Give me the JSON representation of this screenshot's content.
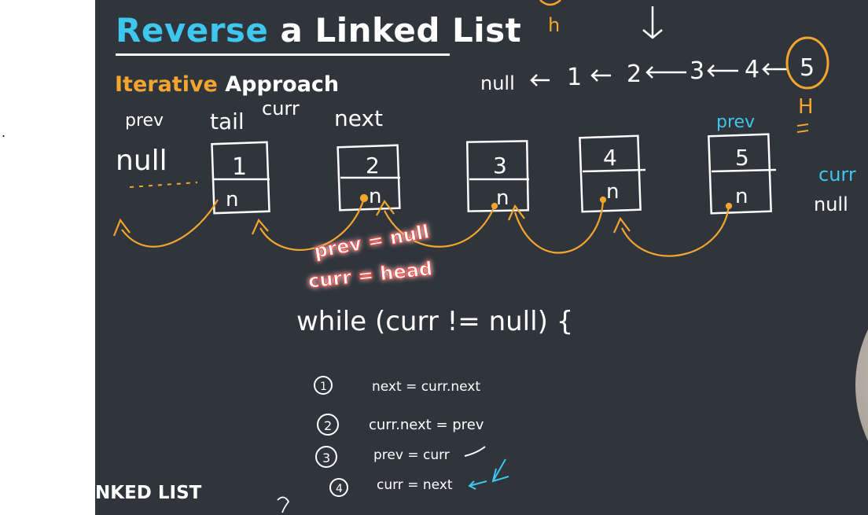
{
  "title": {
    "highlight": "Reverse",
    "rest": " a Linked List"
  },
  "subtitle": {
    "highlight": "Iterative",
    "rest": " Approach"
  },
  "footer": "NKED LIST",
  "colors": {
    "board": "#2f353b",
    "accent_blue": "#3ec6ee",
    "accent_orange": "#f3a52f",
    "highlight_red": "#ff3b30",
    "ink_white": "#ffffff"
  },
  "notes": {
    "reversed_list": {
      "null": "null",
      "nodes": [
        "1",
        "2",
        "3",
        "4",
        "5"
      ],
      "top_h": "h",
      "right_h": "H"
    },
    "pointer_labels": {
      "prev": "prev",
      "tail": "tail",
      "curr": "curr",
      "next": "next",
      "null": "null"
    },
    "nodes": [
      {
        "value": "1",
        "next": "n"
      },
      {
        "value": "2",
        "next": "n"
      },
      {
        "value": "3",
        "next": "n"
      },
      {
        "value": "4",
        "next": "n"
      },
      {
        "value": "5",
        "next": "n"
      }
    ],
    "init": {
      "prev": "prev = null",
      "curr": "curr = head"
    },
    "right_labels": {
      "curr": "curr",
      "null": "null"
    },
    "loop": "while (curr != null) {",
    "steps": [
      {
        "num": "1",
        "code": "next = curr.next"
      },
      {
        "num": "2",
        "code": "curr.next = prev"
      },
      {
        "num": "3",
        "code": "prev = curr"
      },
      {
        "num": "4",
        "code": "curr = next"
      }
    ]
  },
  "icons": [
    "webcam-overlay",
    "arrow-icon"
  ]
}
